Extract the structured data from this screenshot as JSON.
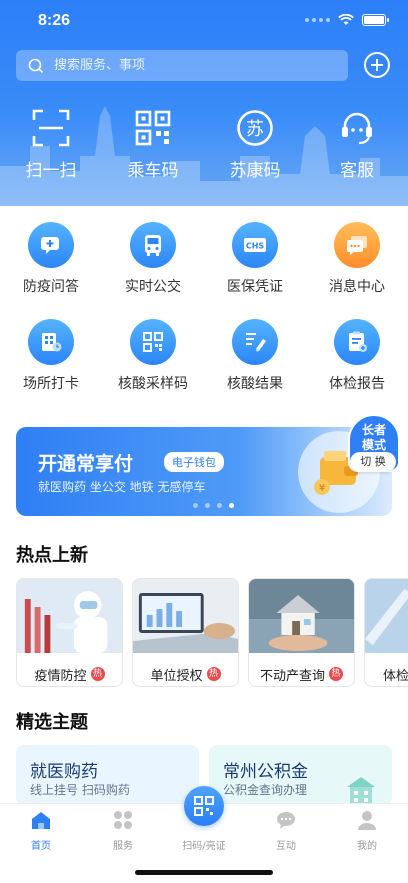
{
  "status": {
    "time": "8:26"
  },
  "search": {
    "placeholder": "搜索服务、事项"
  },
  "quick_actions": [
    {
      "label": "扫一扫",
      "icon": "scan-icon"
    },
    {
      "label": "乘车码",
      "icon": "qrcode-icon"
    },
    {
      "label": "苏康码",
      "icon": "health-code-icon"
    },
    {
      "label": "客服",
      "icon": "customer-service-icon"
    }
  ],
  "services": [
    {
      "label": "防疫问答",
      "icon": "chat-plus-icon"
    },
    {
      "label": "实时公交",
      "icon": "bus-icon"
    },
    {
      "label": "医保凭证",
      "icon": "chs-card-icon",
      "icon_text": "CHS"
    },
    {
      "label": "消息中心",
      "icon": "message-icon"
    },
    {
      "label": "场所打卡",
      "icon": "building-checkin-icon"
    },
    {
      "label": "核酸采样码",
      "icon": "qrcode-icon"
    },
    {
      "label": "核酸结果",
      "icon": "test-tube-icon"
    },
    {
      "label": "体检报告",
      "icon": "report-icon"
    }
  ],
  "banner": {
    "title": "开通常享付",
    "tag": "电子钱包",
    "subtitle": "就医购药 坐公交 地铁 无感停车",
    "active_dot": 4,
    "dot_count": 4
  },
  "elder_mode": {
    "label_line1": "长者",
    "label_line2": "模式",
    "switch": "切 换"
  },
  "hot": {
    "title": "热点上新",
    "badge": "热",
    "items": [
      {
        "label": "疫情防控"
      },
      {
        "label": "单位授权"
      },
      {
        "label": "不动产查询"
      },
      {
        "label": "体检"
      }
    ]
  },
  "themes": {
    "title": "精选主题",
    "items": [
      {
        "title": "就医购药",
        "subtitle": "线上挂号 扫码购药"
      },
      {
        "title": "常州公积金",
        "subtitle": "公积金查询办理"
      }
    ]
  },
  "tabs": [
    {
      "label": "首页",
      "icon": "home-icon",
      "active": true
    },
    {
      "label": "服务",
      "icon": "grid-icon",
      "active": false
    },
    {
      "label": "扫码/亮证",
      "icon": "qrcode-icon",
      "active": false
    },
    {
      "label": "互动",
      "icon": "chat-bubble-icon",
      "active": false
    },
    {
      "label": "我的",
      "icon": "profile-icon",
      "active": false
    }
  ],
  "colors": {
    "primary": "#2f7ff5",
    "accent_orange": "#ff8e2b",
    "hot_red": "#ee4b4b"
  }
}
